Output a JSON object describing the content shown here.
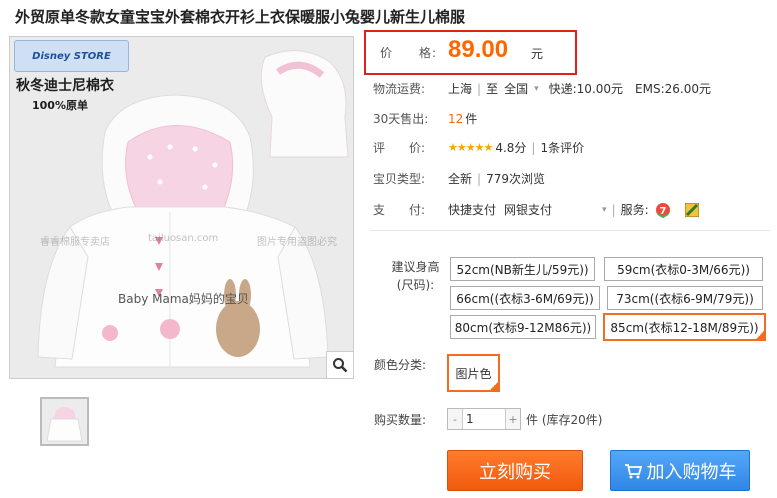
{
  "product": {
    "title": "外贸原单冬款女童宝宝外套棉衣开衫上衣保暖服小兔婴儿新生儿棉服"
  },
  "gallery": {
    "logo_text": "Disney STORE",
    "promo_line1": "秋冬迪士尼棉衣",
    "promo_line2": "100%原单",
    "embroidery_text": "Baby Mama妈妈的宝贝",
    "watermark_1": "睿睿棉服专卖店",
    "watermark_2": "tailuosan.com",
    "watermark_3": "图片专用盗图必究",
    "zoom_icon": "magnifier-icon"
  },
  "price": {
    "label": "价　　格:",
    "value": "89.00",
    "unit": "元"
  },
  "shipping": {
    "label": "物流运费:",
    "from": "上海",
    "to_prefix": "至",
    "to": "全国",
    "express": "快递:10.00元",
    "ems": "EMS:26.00元"
  },
  "sales": {
    "label": "30天售出:",
    "count": "12",
    "unit": "件"
  },
  "rating": {
    "label": "评　　价:",
    "stars": "★★★★★",
    "score": "4.8分",
    "reviews": "1条评价"
  },
  "item_type": {
    "label": "宝贝类型:",
    "condition": "全新",
    "views": "779次浏览"
  },
  "payment": {
    "label": "支　　付:",
    "method1": "快捷支付",
    "method2": "网银支付",
    "service_label": "服务:"
  },
  "size": {
    "label_line1": "建议身高",
    "label_line2": "(尺码):",
    "options": [
      "52cm(NB新生儿/59元))",
      "59cm(衣标0-3M/66元))",
      "66cm((衣标3-6M/69元))",
      "73cm((衣标6-9M/79元))",
      "80cm(衣标9-12M86元))",
      "85cm(衣标12-18M/89元))"
    ],
    "selected_index": 5
  },
  "color": {
    "label": "颜色分类:",
    "option": "图片色"
  },
  "quantity": {
    "label": "购买数量:",
    "value": "1",
    "minus": "-",
    "plus": "+",
    "unit_stock": "件 (库存20件)"
  },
  "actions": {
    "buy_now": "立刻购买",
    "add_to_cart": "加入购物车"
  },
  "colors": {
    "accent_orange": "#ff6600",
    "price_box_border": "#e0201b",
    "buy_button": "#f15a0d",
    "cart_button": "#2f86e6"
  }
}
